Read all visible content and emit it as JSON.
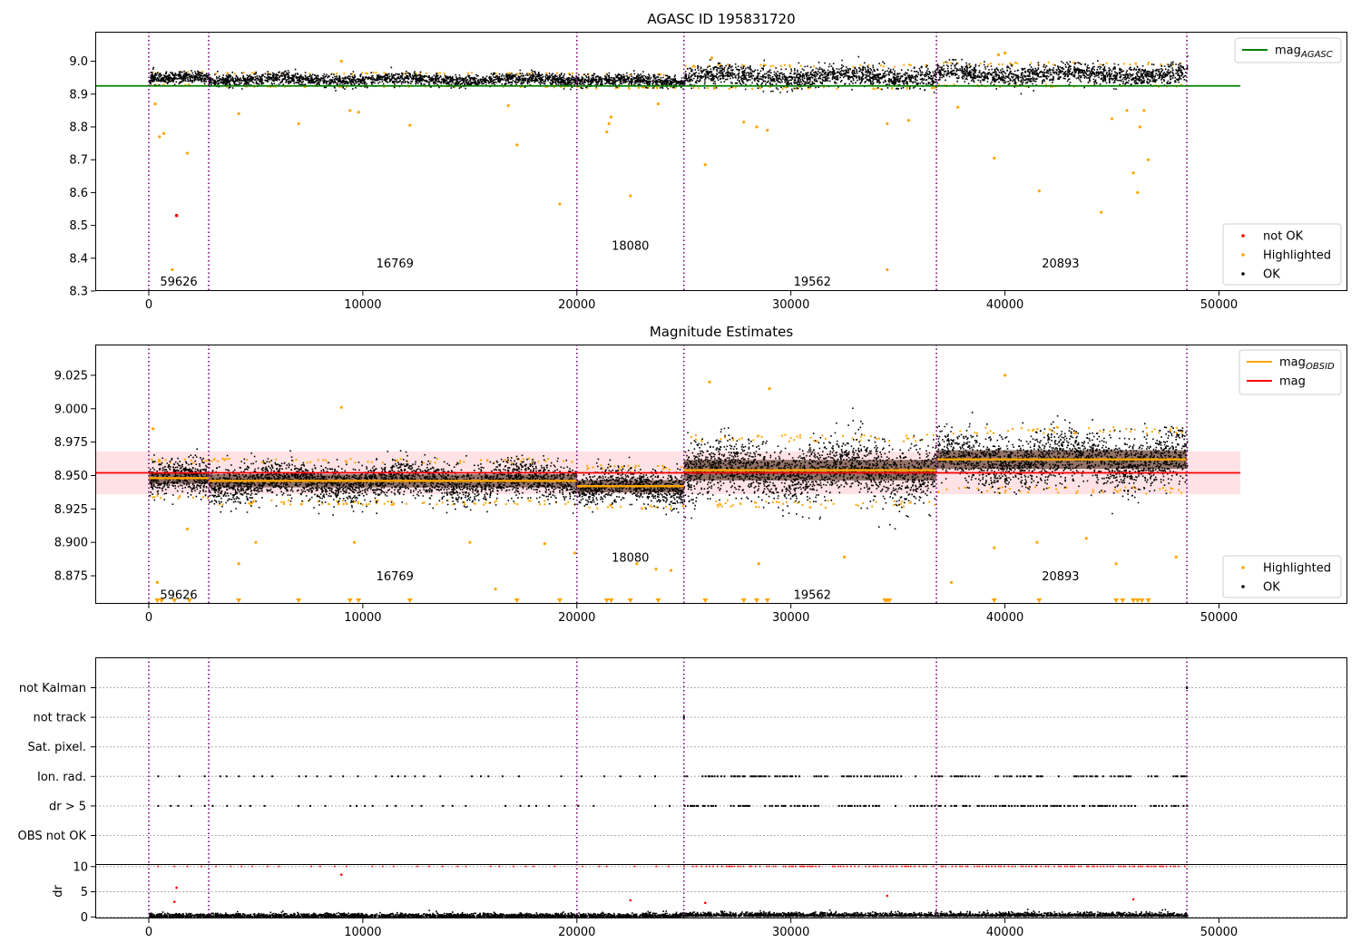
{
  "chart_data": [
    {
      "type": "scatter",
      "title": "AGASC ID 195831720",
      "xlim": [
        -2500,
        56000
      ],
      "ylim": [
        8.3,
        9.09
      ],
      "x_ticks": [
        0,
        10000,
        20000,
        30000,
        40000,
        50000
      ],
      "y_ticks": [
        8.3,
        8.4,
        8.5,
        8.6,
        8.7,
        8.8,
        8.9,
        9.0
      ],
      "y_tick_labels": [
        "8.3",
        "8.4",
        "8.5",
        "8.6",
        "8.7",
        "8.8",
        "8.9",
        "9.0"
      ],
      "obsid_boundaries": [
        0,
        2800,
        20000,
        25000,
        36800,
        48500
      ],
      "obsid_labels": [
        {
          "text": "59626",
          "x": 1400,
          "y": 8.33
        },
        {
          "text": "16769",
          "x": 11500,
          "y": 8.385
        },
        {
          "text": "18080",
          "x": 22500,
          "y": 8.44
        },
        {
          "text": "19562",
          "x": 31000,
          "y": 8.33
        },
        {
          "text": "20893",
          "x": 42600,
          "y": 8.385
        }
      ],
      "segments": [
        {
          "x0": 0,
          "x1": 2800,
          "center": 8.95,
          "half": 0.018
        },
        {
          "x0": 2800,
          "x1": 20000,
          "center": 8.946,
          "half": 0.018
        },
        {
          "x0": 20000,
          "x1": 25000,
          "center": 8.942,
          "half": 0.018
        },
        {
          "x0": 25000,
          "x1": 36800,
          "center": 8.955,
          "half": 0.03
        },
        {
          "x0": 36800,
          "x1": 48500,
          "center": 8.962,
          "half": 0.03
        }
      ],
      "reference_lines": [
        {
          "name": "mag_AGASC",
          "y": 8.925,
          "x0": -2500,
          "x1": 51000,
          "color": "#008000"
        }
      ],
      "outliers": [
        {
          "x": 300,
          "y": 8.87
        },
        {
          "x": 500,
          "y": 8.77
        },
        {
          "x": 700,
          "y": 8.78
        },
        {
          "x": 1800,
          "y": 8.72
        },
        {
          "x": 1100,
          "y": 8.365
        },
        {
          "x": 4200,
          "y": 8.84
        },
        {
          "x": 7000,
          "y": 8.81
        },
        {
          "x": 9400,
          "y": 8.85
        },
        {
          "x": 9800,
          "y": 8.845
        },
        {
          "x": 12200,
          "y": 8.805
        },
        {
          "x": 17200,
          "y": 8.745
        },
        {
          "x": 16800,
          "y": 8.865
        },
        {
          "x": 19200,
          "y": 8.565
        },
        {
          "x": 21400,
          "y": 8.785
        },
        {
          "x": 21600,
          "y": 8.83
        },
        {
          "x": 21500,
          "y": 8.81
        },
        {
          "x": 22500,
          "y": 8.59
        },
        {
          "x": 23800,
          "y": 8.87
        },
        {
          "x": 26000,
          "y": 8.685
        },
        {
          "x": 27800,
          "y": 8.815
        },
        {
          "x": 28400,
          "y": 8.8
        },
        {
          "x": 28900,
          "y": 8.79
        },
        {
          "x": 34500,
          "y": 8.81
        },
        {
          "x": 35500,
          "y": 8.82
        },
        {
          "x": 34500,
          "y": 8.365
        },
        {
          "x": 37800,
          "y": 8.86
        },
        {
          "x": 39500,
          "y": 8.705
        },
        {
          "x": 41600,
          "y": 8.605
        },
        {
          "x": 44500,
          "y": 8.54
        },
        {
          "x": 45000,
          "y": 8.825
        },
        {
          "x": 45700,
          "y": 8.85
        },
        {
          "x": 46000,
          "y": 8.66
        },
        {
          "x": 46300,
          "y": 8.8
        },
        {
          "x": 46200,
          "y": 8.6
        },
        {
          "x": 46700,
          "y": 8.7
        },
        {
          "x": 46500,
          "y": 8.85
        },
        {
          "x": 9000,
          "y": 9.0
        },
        {
          "x": 26300,
          "y": 9.01
        },
        {
          "x": 39700,
          "y": 9.02
        },
        {
          "x": 40000,
          "y": 9.025
        }
      ],
      "not_ok_points": [
        {
          "x": 1300,
          "y": 8.53
        }
      ],
      "legends": [
        {
          "placement": "upper-right",
          "entries": [
            {
              "label": "mag",
              "sub": "AGASC",
              "kind": "line",
              "color": "#008000"
            }
          ]
        },
        {
          "placement": "lower-right",
          "entries": [
            {
              "label": "not OK",
              "kind": "dot",
              "color": "#ff0000"
            },
            {
              "label": "Highlighted",
              "kind": "dot",
              "color": "#ffa500"
            },
            {
              "label": "OK",
              "kind": "dot",
              "color": "#000000"
            }
          ]
        }
      ]
    },
    {
      "type": "scatter",
      "title": "Magnitude Estimates",
      "xlim": [
        -2500,
        56000
      ],
      "ylim": [
        8.854,
        9.048
      ],
      "x_ticks": [
        0,
        10000,
        20000,
        30000,
        40000,
        50000
      ],
      "y_ticks": [
        8.875,
        8.9,
        8.925,
        8.95,
        8.975,
        9.0,
        9.025
      ],
      "y_tick_labels": [
        "8.875",
        "8.900",
        "8.925",
        "8.950",
        "8.975",
        "9.000",
        "9.025"
      ],
      "obsid_boundaries": [
        0,
        2800,
        20000,
        25000,
        36800,
        48500
      ],
      "obsid_labels": [
        {
          "text": "59626",
          "x": 1400,
          "y": 8.861
        },
        {
          "text": "16769",
          "x": 11500,
          "y": 8.875
        },
        {
          "text": "18080",
          "x": 22500,
          "y": 8.889
        },
        {
          "text": "19562",
          "x": 31000,
          "y": 8.861
        },
        {
          "text": "20893",
          "x": 42600,
          "y": 8.875
        }
      ],
      "mag": 8.952,
      "mag_band": [
        8.936,
        8.968
      ],
      "segments": [
        {
          "x0": 0,
          "x1": 2800,
          "center": 8.948,
          "half": 0.012
        },
        {
          "x0": 2800,
          "x1": 20000,
          "center": 8.946,
          "half": 0.014
        },
        {
          "x0": 20000,
          "x1": 25000,
          "center": 8.942,
          "half": 0.013
        },
        {
          "x0": 25000,
          "x1": 36800,
          "center": 8.954,
          "half": 0.022
        },
        {
          "x0": 36800,
          "x1": 48500,
          "center": 8.962,
          "half": 0.02
        }
      ],
      "outliers": [
        {
          "x": 200,
          "y": 8.985
        },
        {
          "x": 400,
          "y": 8.87
        },
        {
          "x": 1800,
          "y": 8.91
        },
        {
          "x": 4200,
          "y": 8.884
        },
        {
          "x": 5000,
          "y": 8.9
        },
        {
          "x": 9000,
          "y": 9.001
        },
        {
          "x": 9600,
          "y": 8.9
        },
        {
          "x": 15000,
          "y": 8.9
        },
        {
          "x": 16200,
          "y": 8.865
        },
        {
          "x": 18500,
          "y": 8.899
        },
        {
          "x": 19900,
          "y": 8.892
        },
        {
          "x": 22800,
          "y": 8.884
        },
        {
          "x": 23700,
          "y": 8.88
        },
        {
          "x": 24400,
          "y": 8.879
        },
        {
          "x": 26200,
          "y": 9.02
        },
        {
          "x": 28500,
          "y": 8.884
        },
        {
          "x": 29000,
          "y": 9.015
        },
        {
          "x": 32500,
          "y": 8.889
        },
        {
          "x": 37500,
          "y": 8.87
        },
        {
          "x": 39500,
          "y": 8.896
        },
        {
          "x": 40000,
          "y": 9.025
        },
        {
          "x": 41500,
          "y": 8.9
        },
        {
          "x": 43800,
          "y": 8.903
        },
        {
          "x": 45200,
          "y": 8.884
        },
        {
          "x": 48000,
          "y": 8.889
        }
      ],
      "clipped_low_x": [
        400,
        600,
        1200,
        1900,
        4200,
        7000,
        9400,
        9800,
        12200,
        17200,
        19200,
        21400,
        21600,
        22500,
        23800,
        26000,
        27800,
        28400,
        28900,
        34400,
        34500,
        34600,
        39500,
        41600,
        45200,
        45500,
        46000,
        46200,
        46400,
        46700
      ],
      "reference_lines": [
        {
          "name": "mag",
          "y": 8.952,
          "x0": -2500,
          "x1": 51000,
          "color": "#ff0000"
        }
      ],
      "legends": [
        {
          "placement": "upper-right",
          "entries": [
            {
              "label": "mag",
              "sub": "OBSID",
              "kind": "line",
              "color": "#ffa500"
            },
            {
              "label": "mag",
              "kind": "line",
              "color": "#ff0000"
            }
          ]
        },
        {
          "placement": "lower-right",
          "entries": [
            {
              "label": "Highlighted",
              "kind": "dot",
              "color": "#ffa500"
            },
            {
              "label": "OK",
              "kind": "dot",
              "color": "#000000"
            }
          ]
        }
      ]
    },
    {
      "type": "scatter",
      "title": "",
      "xlim": [
        -2500,
        56000
      ],
      "categories": [
        "not Kalman",
        "not track",
        "Sat. pixel.",
        "Ion. rad.",
        "dr > 5",
        "OBS not OK"
      ],
      "obsid_boundaries": [
        0,
        2800,
        20000,
        25000,
        36800,
        48500
      ],
      "flag_events": {
        "not track": [
          25000
        ],
        "not Kalman": [
          48500
        ],
        "Ion. rad.": "dense after 25000, periodic before",
        "dr > 5": "dense after 25000, periodic before"
      }
    },
    {
      "type": "scatter",
      "title": "",
      "xlim": [
        -2500,
        56000
      ],
      "ylim": [
        -0.3,
        10.5
      ],
      "ylabel": "dr",
      "x_ticks": [
        0,
        10000,
        20000,
        30000,
        40000,
        50000
      ],
      "y_ticks": [
        0,
        5,
        10
      ],
      "y_tick_labels": [
        "0",
        "5",
        "10"
      ],
      "obsid_boundaries": [
        0,
        2800,
        20000,
        25000,
        36800,
        48500
      ],
      "red_outliers": [
        {
          "x": 1200,
          "y": 3.0
        },
        {
          "x": 1300,
          "y": 5.8
        },
        {
          "x": 9000,
          "y": 8.4
        },
        {
          "x": 22500,
          "y": 3.3
        },
        {
          "x": 26000,
          "y": 2.8
        },
        {
          "x": 34500,
          "y": 4.2
        },
        {
          "x": 46000,
          "y": 3.5
        }
      ]
    }
  ]
}
